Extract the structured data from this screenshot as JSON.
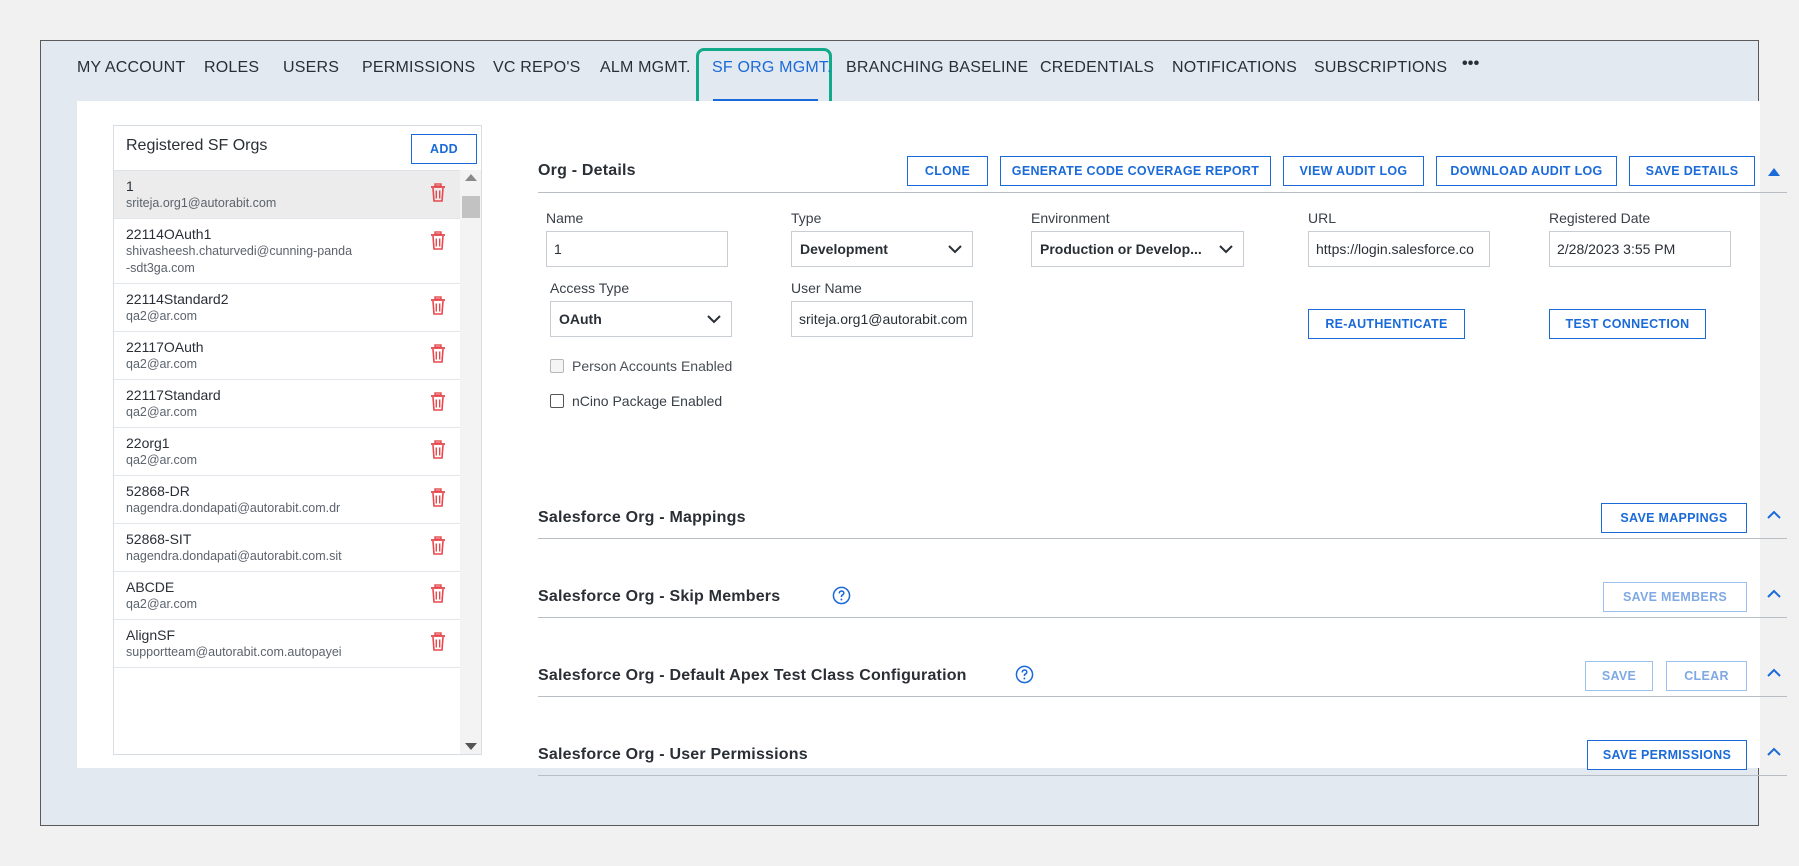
{
  "tabs": [
    {
      "label": "MY ACCOUNT",
      "active": false
    },
    {
      "label": "ROLES",
      "active": false
    },
    {
      "label": "USERS",
      "active": false
    },
    {
      "label": "PERMISSIONS",
      "active": false
    },
    {
      "label": "VC REPO'S",
      "active": false
    },
    {
      "label": "ALM MGMT.",
      "active": false
    },
    {
      "label": "SF ORG MGMT.",
      "active": true
    },
    {
      "label": "BRANCHING BASELINE",
      "active": false
    },
    {
      "label": "CREDENTIALS",
      "active": false
    },
    {
      "label": "NOTIFICATIONS",
      "active": false
    },
    {
      "label": "SUBSCRIPTIONS",
      "active": false
    },
    {
      "label": "•••",
      "active": false
    }
  ],
  "orgs_panel": {
    "title": "Registered SF Orgs",
    "add_label": "ADD",
    "items": [
      {
        "name": "1",
        "email": "sriteja.org1@autorabit.com",
        "selected": true
      },
      {
        "name": "22114OAuth1",
        "email": "shivasheesh.chaturvedi@cunning-panda-sdt3ga.com",
        "selected": false
      },
      {
        "name": "22114Standard2",
        "email": "qa2@ar.com",
        "selected": false
      },
      {
        "name": "22117OAuth",
        "email": "qa2@ar.com",
        "selected": false
      },
      {
        "name": "22117Standard",
        "email": "qa2@ar.com",
        "selected": false
      },
      {
        "name": "22org1",
        "email": "qa2@ar.com",
        "selected": false
      },
      {
        "name": "52868-DR",
        "email": "nagendra.dondapati@autorabit.com.dr",
        "selected": false
      },
      {
        "name": "52868-SIT",
        "email": "nagendra.dondapati@autorabit.com.sit",
        "selected": false
      },
      {
        "name": "ABCDE",
        "email": "qa2@ar.com",
        "selected": false
      },
      {
        "name": "AlignSF",
        "email": "supportteam@autorabit.com.autopayei",
        "selected": false
      }
    ]
  },
  "org_details": {
    "title": "Org - Details",
    "buttons": {
      "clone": "CLONE",
      "coverage": "GENERATE CODE COVERAGE REPORT",
      "view_audit": "VIEW AUDIT LOG",
      "download_audit": "DOWNLOAD AUDIT LOG",
      "save_details": "SAVE DETAILS"
    },
    "fields": {
      "name_label": "Name",
      "name_value": "1",
      "type_label": "Type",
      "type_value": "Development",
      "environment_label": "Environment",
      "environment_value": "Production or Develop...",
      "url_label": "URL",
      "url_value": "https://login.salesforce.co",
      "registered_label": "Registered Date",
      "registered_value": "2/28/2023  3:55 PM",
      "access_type_label": "Access Type",
      "access_type_value": "OAuth",
      "user_name_label": "User Name",
      "user_name_value": "sriteja.org1@autorabit.com"
    },
    "reauth_label": "RE-AUTHENTICATE",
    "test_connection_label": "TEST CONNECTION",
    "person_accounts_label": "Person Accounts Enabled",
    "ncino_label": "nCino Package Enabled"
  },
  "sections": {
    "mappings": {
      "title": "Salesforce Org - Mappings",
      "button": "SAVE MAPPINGS"
    },
    "skip_members": {
      "title": "Salesforce Org - Skip Members",
      "button": "SAVE MEMBERS"
    },
    "apex_test": {
      "title": "Salesforce Org - Default Apex Test Class Configuration",
      "save": "SAVE",
      "clear": "CLEAR"
    },
    "user_permissions": {
      "title": "Salesforce Org - User Permissions",
      "button": "SAVE PERMISSIONS"
    }
  },
  "colors": {
    "accent": "#1a6ad9",
    "active_tab_highlight": "#11a98a",
    "delete_icon": "#e5484d"
  }
}
